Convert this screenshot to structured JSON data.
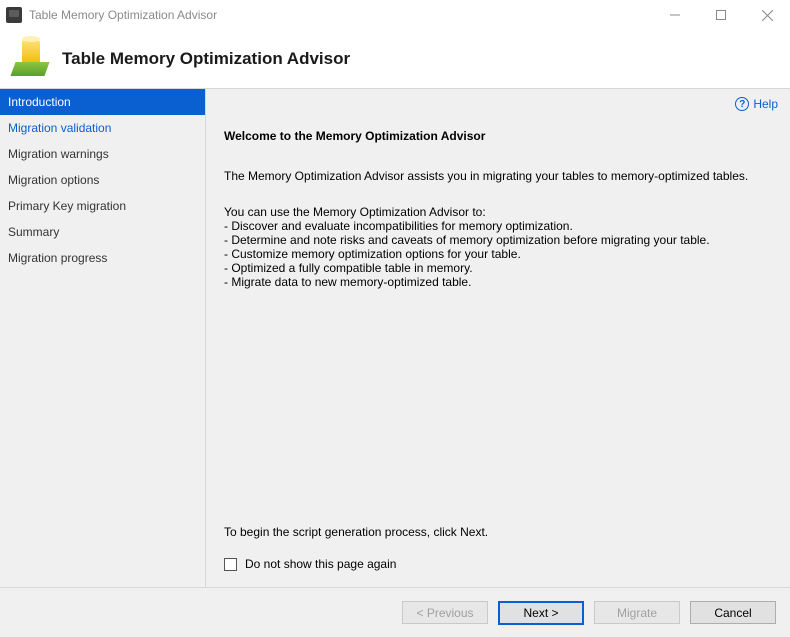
{
  "window": {
    "title": "Table Memory Optimization Advisor"
  },
  "header": {
    "title": "Table Memory Optimization Advisor"
  },
  "sidebar": {
    "items": [
      {
        "label": "Introduction"
      },
      {
        "label": "Migration validation"
      },
      {
        "label": "Migration warnings"
      },
      {
        "label": "Migration options"
      },
      {
        "label": "Primary Key migration"
      },
      {
        "label": "Summary"
      },
      {
        "label": "Migration progress"
      }
    ]
  },
  "help": {
    "label": "Help"
  },
  "content": {
    "welcome": "Welcome to the Memory Optimization Advisor",
    "intro": "The Memory Optimization Advisor assists you in migrating your tables to memory-optimized tables.",
    "uses_head": "You can use the Memory Optimization Advisor to:",
    "uses": [
      "- Discover and evaluate incompatibilities for memory optimization.",
      "- Determine and note risks and caveats of memory optimization before migrating your table.",
      "- Customize memory optimization options for your table.",
      "- Optimized a fully compatible table in memory.",
      "- Migrate data to new memory-optimized table."
    ],
    "begin": "To begin the script generation process, click Next.",
    "dns": "Do not show this page again"
  },
  "buttons": {
    "previous": "< Previous",
    "next": "Next >",
    "migrate": "Migrate",
    "cancel": "Cancel"
  }
}
